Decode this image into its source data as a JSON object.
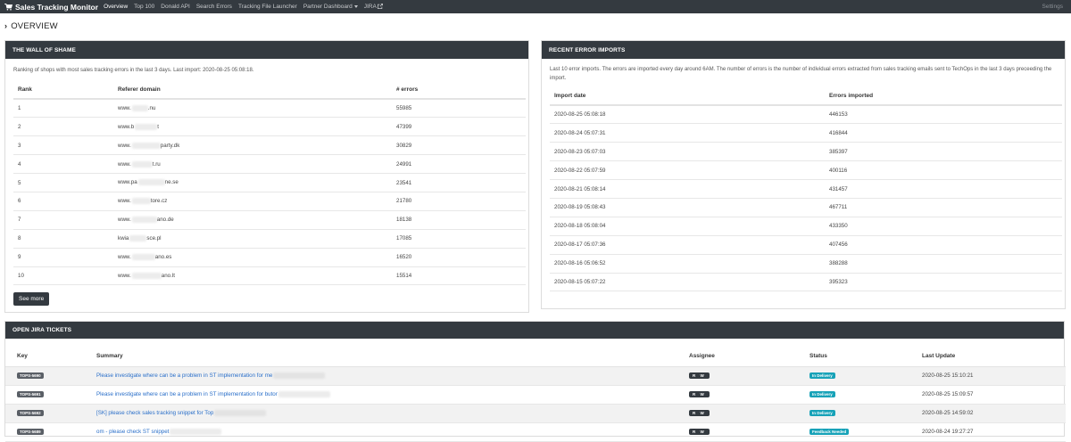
{
  "navbar": {
    "brand": "Sales Tracking Monitor",
    "brand_icon": "cart-icon",
    "items": [
      {
        "label": "Overview",
        "active": true
      },
      {
        "label": "Top 100"
      },
      {
        "label": "Donald API"
      },
      {
        "label": "Search Errors"
      },
      {
        "label": "Tracking File Launcher"
      },
      {
        "label": "Partner Dashboard"
      },
      {
        "label": "JIRA"
      }
    ],
    "right": "Settings"
  },
  "page": {
    "title": "OVERVIEW"
  },
  "wall_of_shame": {
    "title": "THE WALL OF SHAME",
    "description": "Ranking of shops with most sales tracking errors in the last 3 days. Last import: 2020-08-25 05:08:18.",
    "columns": [
      "Rank",
      "Referer domain",
      "# errors"
    ],
    "rows": [
      {
        "rank": "1",
        "domain": "www.",
        "domain_tail": ".nu",
        "errors": "55985"
      },
      {
        "rank": "2",
        "domain": "www.b",
        "domain_tail": "t",
        "errors": "47399"
      },
      {
        "rank": "3",
        "domain": "www.",
        "domain_tail": "party.dk",
        "errors": "30829"
      },
      {
        "rank": "4",
        "domain": "www.",
        "domain_tail": "t.ru",
        "errors": "24991"
      },
      {
        "rank": "5",
        "domain": "www.pa",
        "domain_tail": "ne.se",
        "errors": "23541"
      },
      {
        "rank": "6",
        "domain": "www.",
        "domain_tail": "tore.cz",
        "errors": "21780"
      },
      {
        "rank": "7",
        "domain": "www.",
        "domain_tail": "ano.de",
        "errors": "18138"
      },
      {
        "rank": "8",
        "domain": "kwia",
        "domain_tail": "sce.pl",
        "errors": "17085"
      },
      {
        "rank": "9",
        "domain": "www.",
        "domain_tail": "ano.es",
        "errors": "16520"
      },
      {
        "rank": "10",
        "domain": "www.",
        "domain_tail": "ano.lt",
        "errors": "15514"
      }
    ],
    "see_more": "See more"
  },
  "recent_imports": {
    "title": "RECENT ERROR IMPORTS",
    "description": "Last 10 error imports. The errors are imported every day around 6AM. The number of errors is the number of individual errors extracted from sales tracking emails sent to TechOps in the last 3 days preceeding the import.",
    "columns": [
      "Import date",
      "Errors imported"
    ],
    "rows": [
      {
        "date": "2020-08-25 05:08:18",
        "count": "446153"
      },
      {
        "date": "2020-08-24 05:07:31",
        "count": "416844"
      },
      {
        "date": "2020-08-23 05:07:03",
        "count": "385397"
      },
      {
        "date": "2020-08-22 05:07:59",
        "count": "400116"
      },
      {
        "date": "2020-08-21 05:08:14",
        "count": "431457"
      },
      {
        "date": "2020-08-19 05:08:43",
        "count": "467711"
      },
      {
        "date": "2020-08-18 05:08:04",
        "count": "433350"
      },
      {
        "date": "2020-08-17 05:07:36",
        "count": "407456"
      },
      {
        "date": "2020-08-16 05:06:52",
        "count": "388288"
      },
      {
        "date": "2020-08-15 05:07:22",
        "count": "395323"
      }
    ]
  },
  "jira": {
    "title": "OPEN JIRA TICKETS",
    "columns": [
      "Key",
      "Summary",
      "Assignee",
      "Status",
      "Last Update"
    ],
    "rows": [
      {
        "key": "TOPS-5690",
        "summary": "Please investigate where can be a problem in ST implementation for me",
        "assignee": "R W",
        "status": "In Delivery",
        "status_color": "#17a2b8",
        "updated": "2020-08-25 15:10:21"
      },
      {
        "key": "TOPS-5691",
        "summary": "Please investigate where can be a problem in ST implementation for butor",
        "assignee": "R W",
        "status": "In Delivery",
        "status_color": "#17a2b8",
        "updated": "2020-08-25 15:09:57"
      },
      {
        "key": "TOPS-5692",
        "summary": "[SK] please check sales tracking snippet for Top",
        "assignee": "R W",
        "status": "In Delivery",
        "status_color": "#17a2b8",
        "updated": "2020-08-25 14:59:02"
      },
      {
        "key": "TOPS-5689",
        "summary": "om - please check ST snippet",
        "assignee": "R W",
        "status": "Feedback Needed",
        "status_color": "#17a2b8",
        "updated": "2020-08-24 19:27:27"
      }
    ]
  },
  "colors": {
    "navbar": "#343a40",
    "link": "#2a6fc9",
    "status": "#17a2b8"
  }
}
